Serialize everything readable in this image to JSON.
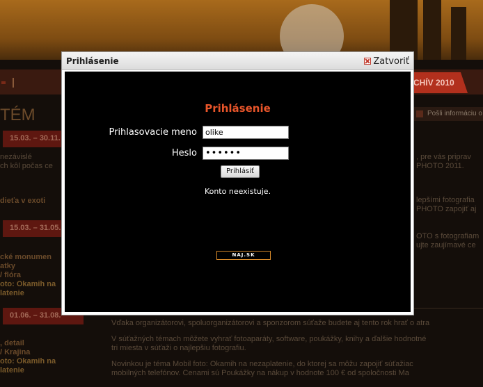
{
  "modal": {
    "title": "Prihlásenie",
    "close_label": "Zatvoriť",
    "heading": "Prihlásenie",
    "username_label": "Prihlasovacie meno",
    "username_value": "olike",
    "password_label": "Heslo",
    "password_value": "••••••",
    "login_button": "Prihlásiť",
    "status_message": "Konto neexistuje.",
    "logo_text": "NAJ.SK"
  },
  "background": {
    "nav_tab": "CHÍV 2010",
    "title": "TÉM",
    "share_label": "Pošli informáciu o",
    "dates": [
      "15.03. – 30.11.",
      "15.03. – 31.05.",
      "01.06. – 31.08."
    ],
    "left_texts": [
      "nezávislé",
      "ch kôl počas ce",
      "dieťa v exoti",
      "cké monumen",
      "atky",
      "/ flóra",
      "oto: Okamih na",
      "latenie",
      ", detail",
      "/ Krajina",
      "oto: Okamih na",
      "latenie"
    ],
    "right_texts": [
      ", pre vás priprav",
      "PHOTO 2011.",
      "lepšími fotografia",
      "PHOTO zapojiť aj",
      "OTO s fotografiam",
      "ujte zaujímavé ce"
    ],
    "bottom_texts": [
      "Vďaka organizátorovi, spoluorganizátorovi a sponzorom súťaže budete aj tento rok hrať o atra",
      "V súťažných témach môžete vyhrať fotoaparáty, software, poukážky, knihy a ďalšie hodnotné",
      "tri miesta v súťaži o najlepšiu fotografiu.",
      "Novinkou je téma Mobil foto: Okamih na nezaplatenie, do ktorej sa môžu zapojiť súťažiac",
      "mobilných telefónov. Cenami sú Poukážky na nákup v hodnote 100 € od spoločnosti Ma"
    ]
  },
  "colors": {
    "heading_accent": "#e8552a",
    "modal_body": "#000000",
    "logo_border": "#d98a2a"
  }
}
